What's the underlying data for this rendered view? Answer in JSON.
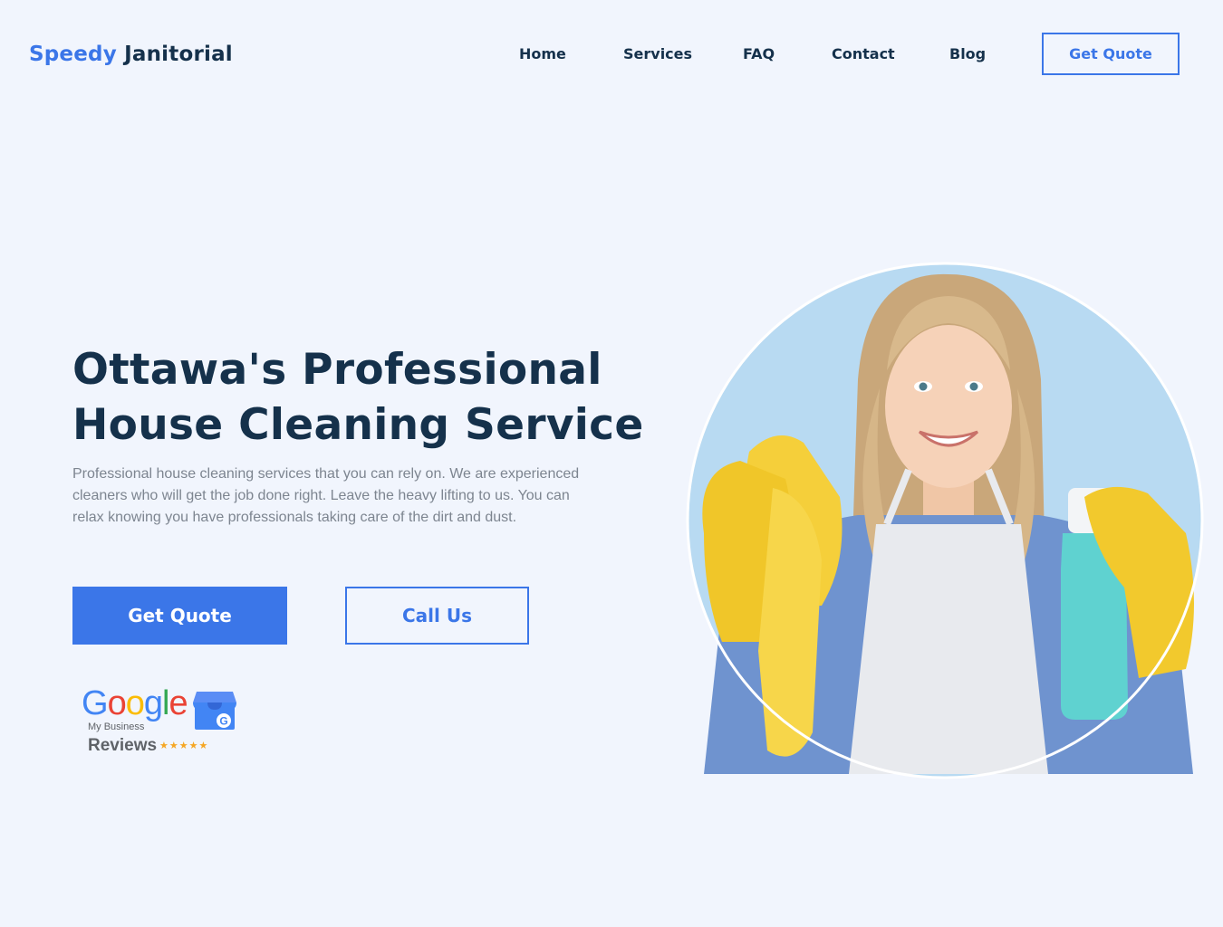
{
  "header": {
    "logo": {
      "part1": "Speedy",
      "part2": "Janitorial"
    },
    "nav": [
      "Home",
      "Services",
      "FAQ",
      "Contact",
      "Blog"
    ],
    "cta_label": "Get Quote"
  },
  "hero": {
    "title_line1": "Ottawa's Professional",
    "title_line2": "House Cleaning Service",
    "description": "Professional house cleaning services that you can rely on. We are experienced cleaners who will get the job done right. Leave the heavy lifting to us. You can relax knowing you have professionals taking care of the dirt and dust.",
    "primary_button": "Get Quote",
    "secondary_button": "Call Us"
  },
  "badge": {
    "google_letters": [
      "G",
      "o",
      "o",
      "g",
      "l",
      "e"
    ],
    "subtitle": "My Business",
    "reviews_label": "Reviews",
    "stars": "★★★★★",
    "rating": 5,
    "store_letter": "G"
  },
  "colors": {
    "brand_blue": "#3b76e8",
    "navy": "#15314b",
    "background": "#f1f5fd",
    "body_text": "#7d8590"
  }
}
